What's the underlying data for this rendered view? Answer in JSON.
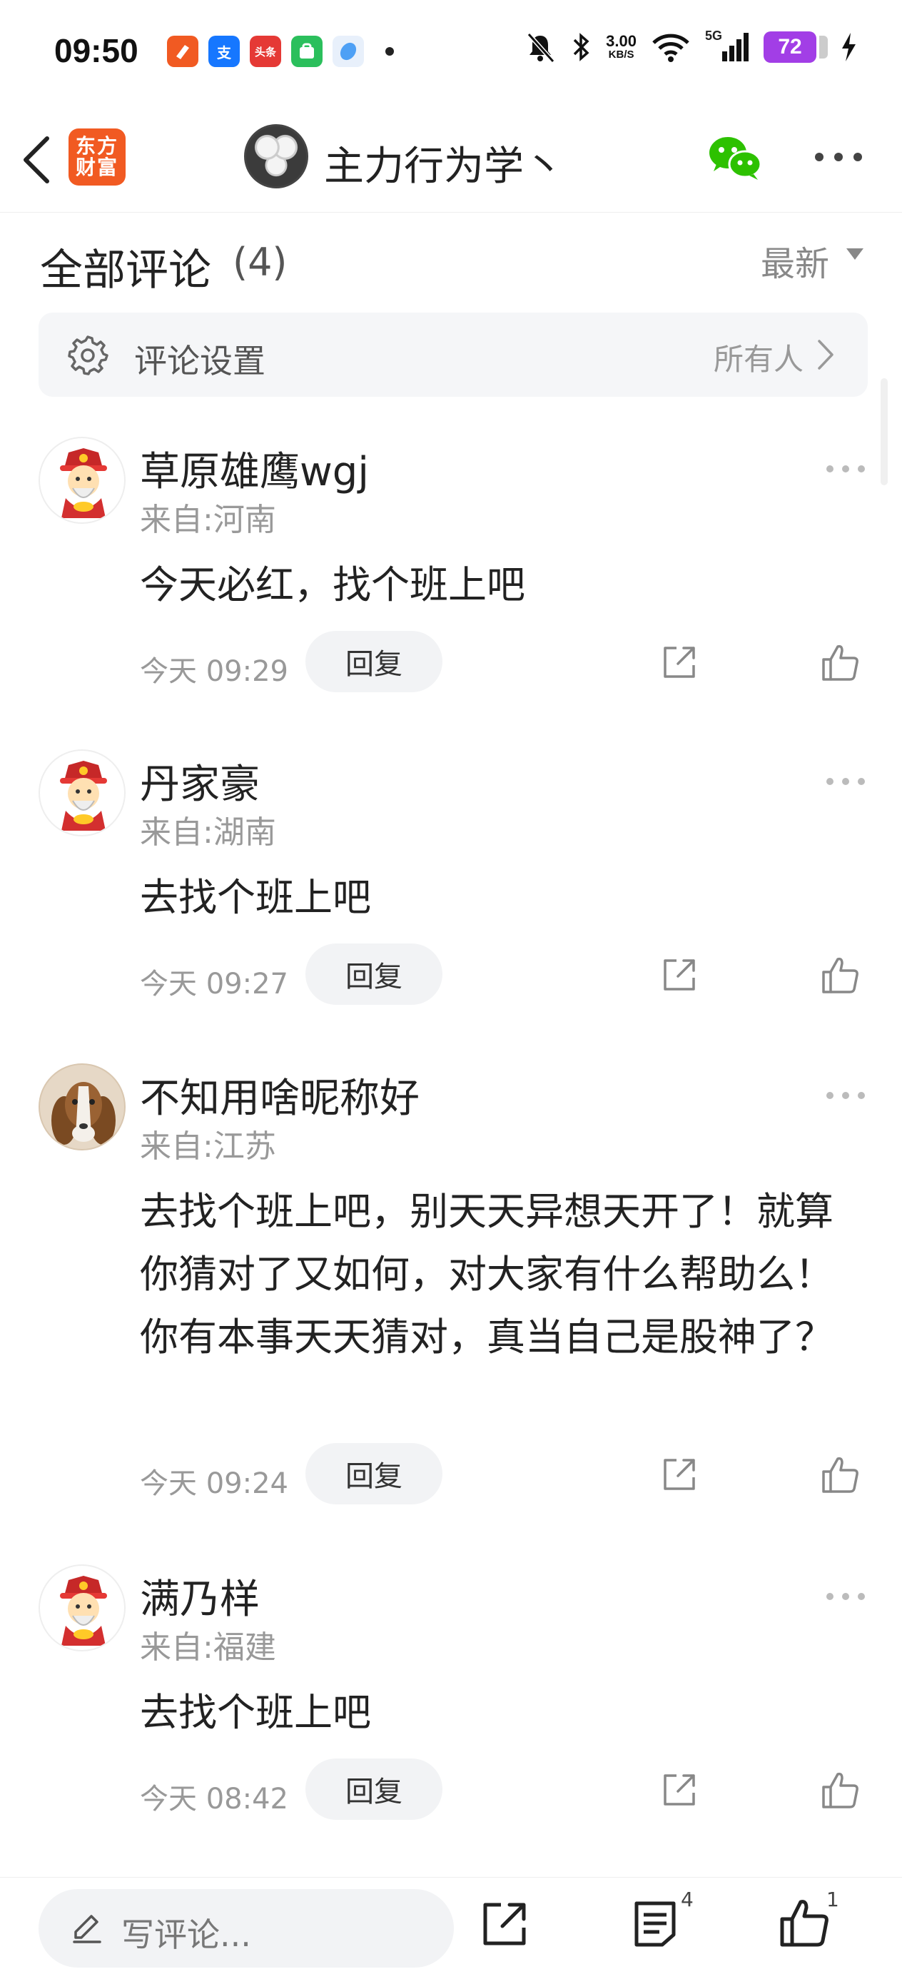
{
  "status_bar": {
    "time": "09:50",
    "net_speed": "3.00",
    "net_speed_unit": "KB/S",
    "network": "5G",
    "battery": "72",
    "notification_apps": [
      {
        "icon": "east-money-app-icon",
        "label": "",
        "color": "#f15a22"
      },
      {
        "icon": "alipay-app-icon",
        "label": "支",
        "color": "#1677ff"
      },
      {
        "icon": "toutiao-app-icon",
        "label": "头条",
        "color": "#e53935"
      },
      {
        "icon": "store-app-icon",
        "label": "",
        "color": "#2bbf5c"
      },
      {
        "icon": "browser-app-icon",
        "label": "",
        "color": "#4ea0f5"
      }
    ]
  },
  "nav": {
    "logo_line1": "东方",
    "logo_line2": "财富",
    "title": "主力行为学丶"
  },
  "comments_header": {
    "title": "全部评论",
    "count": "(4)",
    "sort": "最新"
  },
  "settings": {
    "label": "评论设置",
    "value": "所有人"
  },
  "comments": [
    {
      "name": "草原雄鹰wgj",
      "location": "来自:河南",
      "text": "今天必红，找个班上吧",
      "time": "今天 09:29",
      "reply": "回复",
      "avatar": "caishen-avatar"
    },
    {
      "name": "丹家豪",
      "location": "来自:湖南",
      "text": "去找个班上吧",
      "time": "今天 09:27",
      "reply": "回复",
      "avatar": "caishen-avatar"
    },
    {
      "name": "不知用啥昵称好",
      "location": "来自:江苏",
      "text": "去找个班上吧，别天天异想天开了！就算你猜对了又如何，对大家有什么帮助么！你有本事天天猜对，真当自己是股神了？",
      "time": "今天 09:24",
      "reply": "回复",
      "avatar": "dog-avatar"
    },
    {
      "name": "满乃样",
      "location": "来自:福建",
      "text": "去找个班上吧",
      "time": "今天 08:42",
      "reply": "回复",
      "avatar": "caishen-avatar"
    }
  ],
  "bottom_bar": {
    "placeholder": "写评论...",
    "comment_count": "4",
    "like_count": "1"
  },
  "colors": {
    "brand": "#f15a22",
    "wechat": "#2dc100",
    "battery": "#a23ee6",
    "muted_text": "#999999"
  }
}
